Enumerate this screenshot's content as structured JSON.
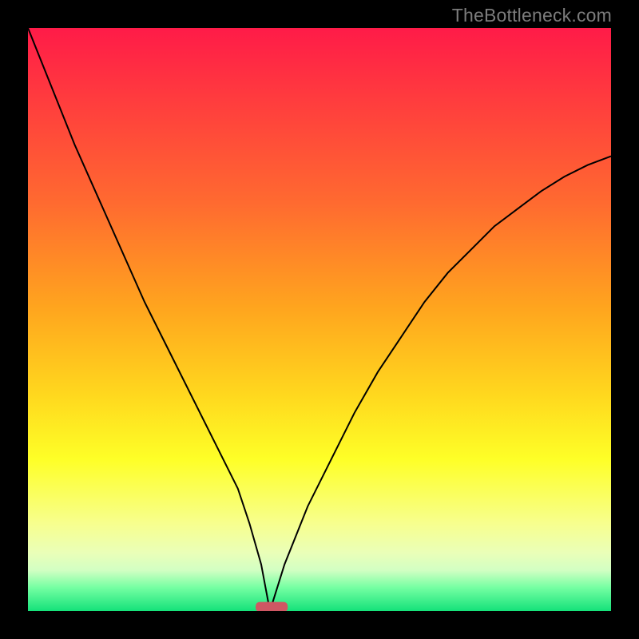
{
  "watermark": "TheBottleneck.com",
  "chart_data": {
    "type": "line",
    "title": "",
    "xlabel": "",
    "ylabel": "",
    "xlim": [
      0,
      100
    ],
    "ylim": [
      0,
      100
    ],
    "grid": false,
    "legend": false,
    "notes": "Background is a vertical color gradient from red at top through orange and yellow to green at bottom; no numeric axis ticks shown.",
    "gradient_stops": [
      {
        "offset": 0,
        "color": "#ff1b48"
      },
      {
        "offset": 12,
        "color": "#ff3b3e"
      },
      {
        "offset": 30,
        "color": "#ff6a30"
      },
      {
        "offset": 48,
        "color": "#ffa51e"
      },
      {
        "offset": 63,
        "color": "#ffd81e"
      },
      {
        "offset": 74,
        "color": "#feff27"
      },
      {
        "offset": 85,
        "color": "#f7ff8e"
      },
      {
        "offset": 90,
        "color": "#eaffb8"
      },
      {
        "offset": 93,
        "color": "#d2ffc3"
      },
      {
        "offset": 96,
        "color": "#74ffa2"
      },
      {
        "offset": 100,
        "color": "#14e27a"
      }
    ],
    "series": [
      {
        "name": "curve",
        "stroke": "#000000",
        "x": [
          0,
          4,
          8,
          12,
          16,
          20,
          24,
          28,
          32,
          36,
          38,
          40,
          41.5,
          44,
          48,
          52,
          56,
          60,
          64,
          68,
          72,
          76,
          80,
          84,
          88,
          92,
          96,
          100
        ],
        "y": [
          100,
          90,
          80,
          71,
          62,
          53,
          45,
          37,
          29,
          21,
          15,
          8,
          0,
          8,
          18,
          26,
          34,
          41,
          47,
          53,
          58,
          62,
          66,
          69,
          72,
          74.5,
          76.5,
          78
        ]
      }
    ],
    "marker": {
      "shape": "rounded-rect",
      "center_x": 41.8,
      "center_y": 0.7,
      "width": 5.5,
      "height": 1.7,
      "color": "#cf5763"
    }
  }
}
